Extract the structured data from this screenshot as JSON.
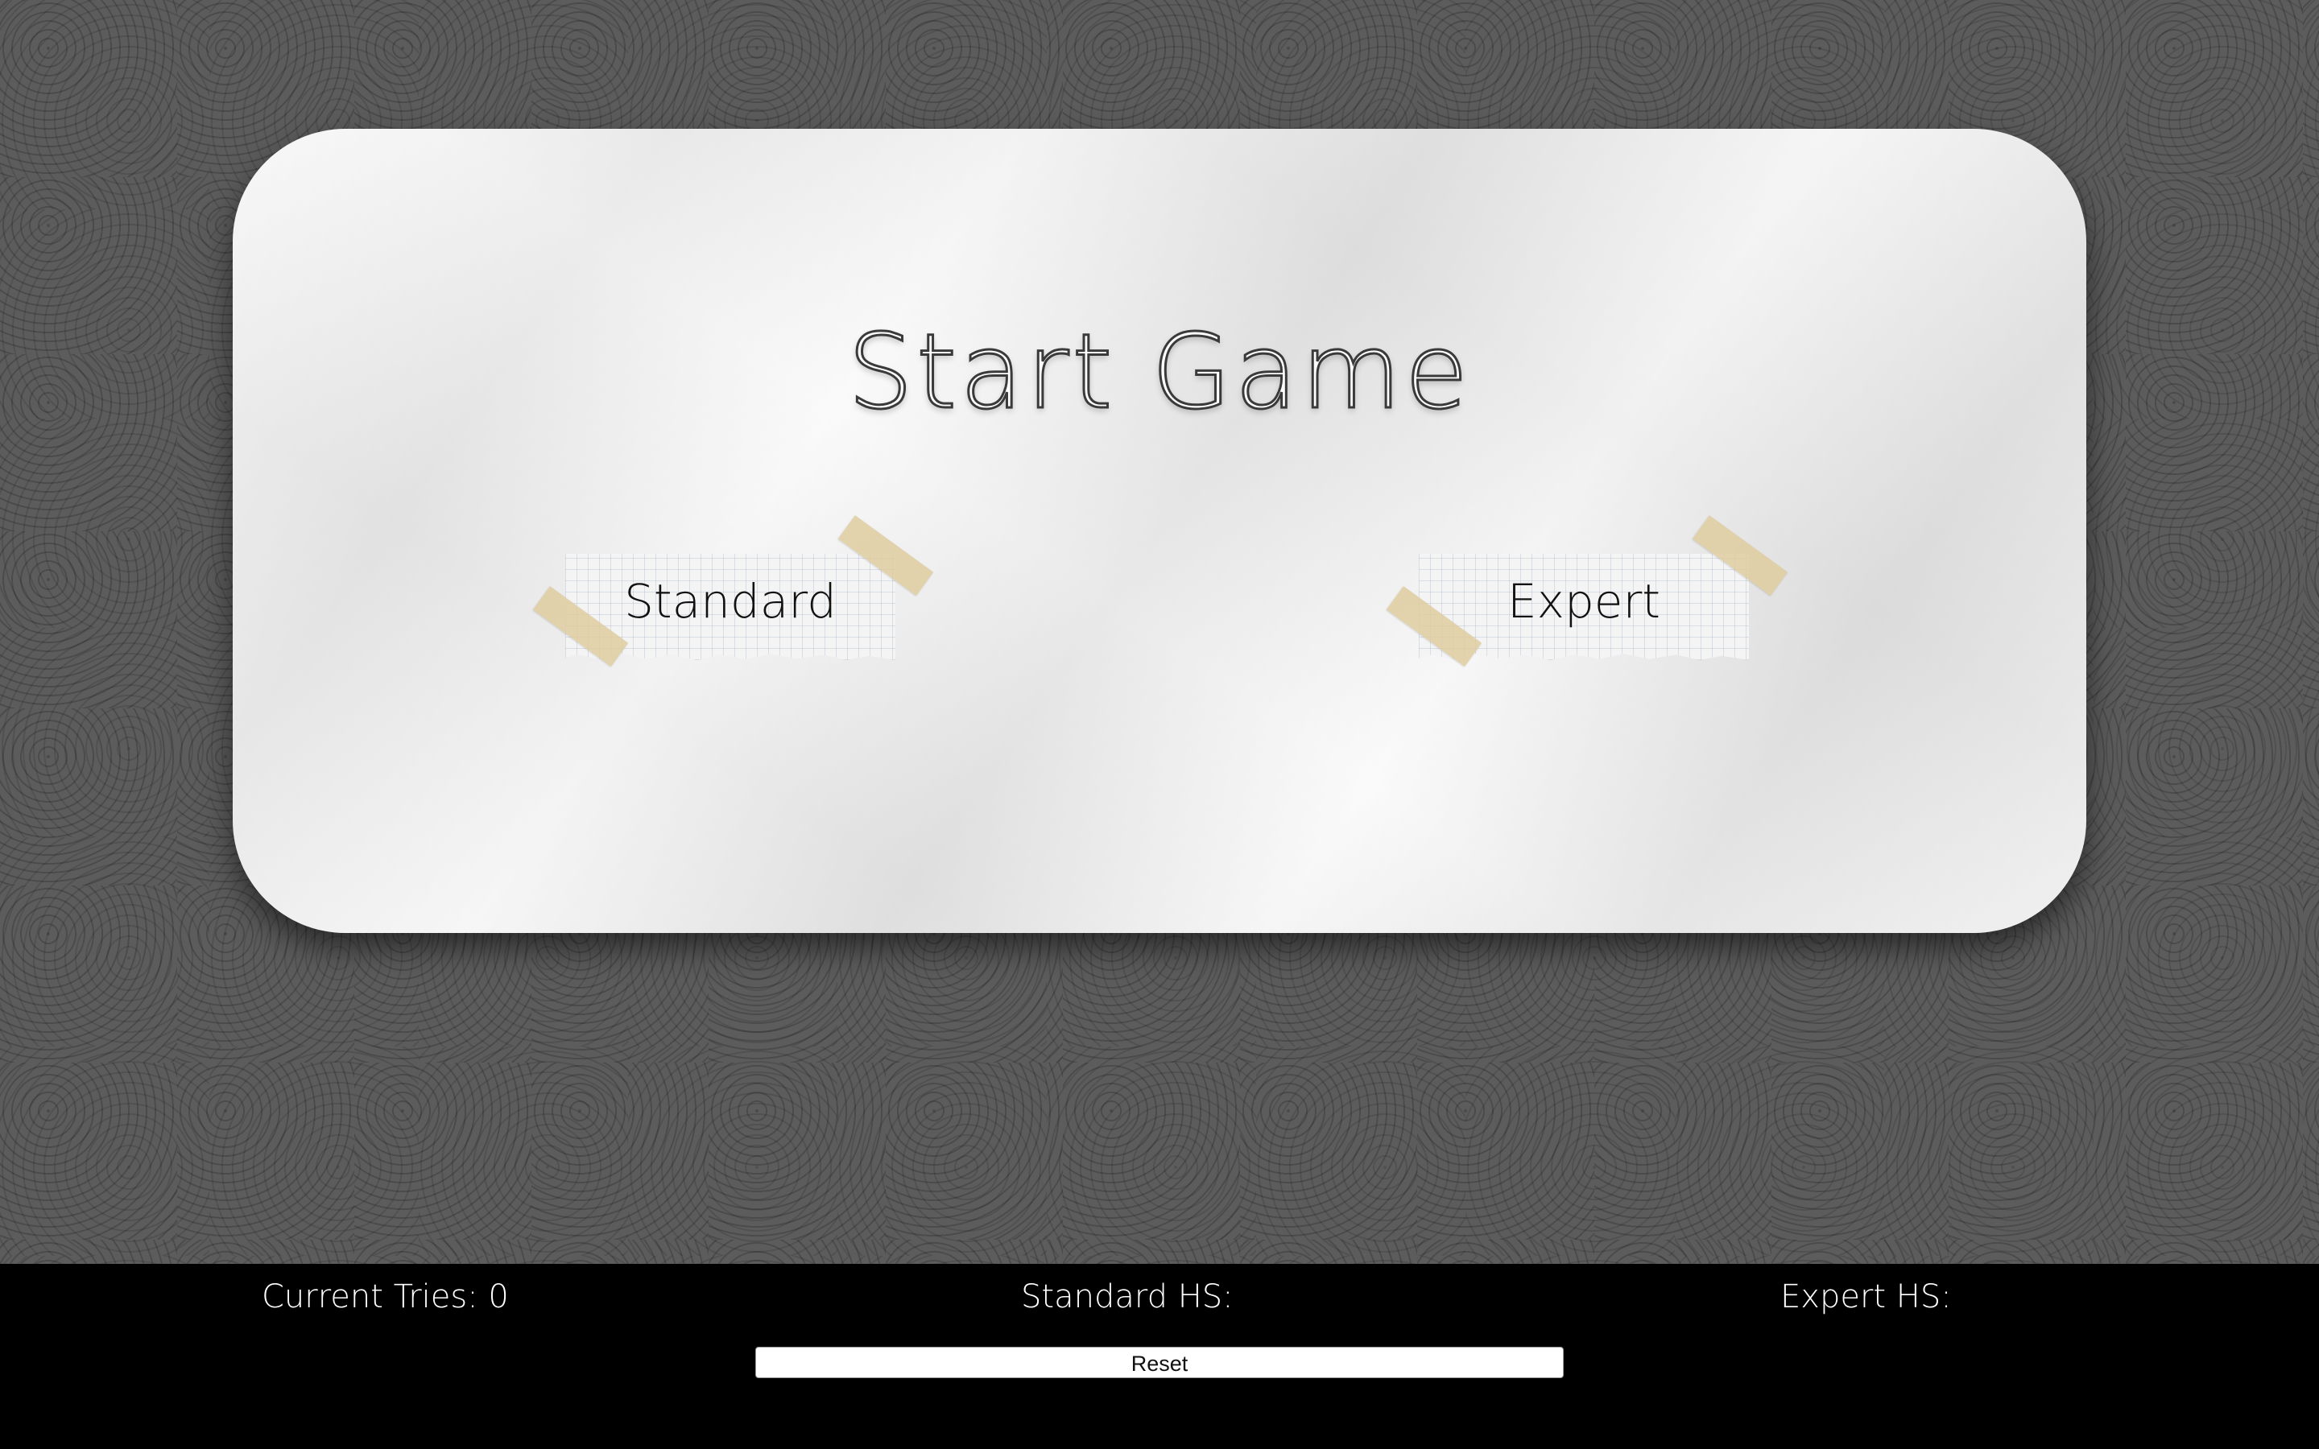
{
  "game": {
    "title": "Start Game",
    "modes": {
      "standard": "Standard",
      "expert": "Expert"
    }
  },
  "footer": {
    "current_tries_label": "Current Tries:",
    "current_tries_value": "0",
    "standard_hs_label": "Standard HS:",
    "standard_hs_value": "",
    "expert_hs_label": "Expert HS:",
    "expert_hs_value": "",
    "reset_label": "Reset"
  },
  "colors": {
    "footer_background": "#000000",
    "tape": "#decda0"
  }
}
